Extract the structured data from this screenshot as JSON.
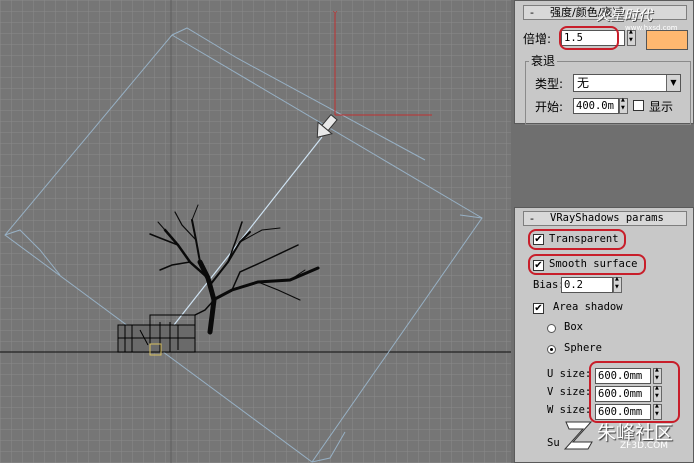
{
  "intensity_rollout": {
    "header": "强度/颜色/衰减",
    "multiplier_label": "倍增:",
    "multiplier_value": "1.5",
    "color": "#ffb870",
    "decay_group_label": "衰退",
    "type_label": "类型:",
    "type_value": "无",
    "start_label": "开始:",
    "start_value": "400.0m",
    "show_label": "显示"
  },
  "shadow_rollout": {
    "header": "VRayShadows params",
    "transparent_label": "Transparent",
    "transparent_checked": true,
    "smooth_surface_label": "Smooth surface",
    "smooth_surface_checked": true,
    "bias_label": "Bias:",
    "bias_value": "0.2",
    "area_shadow_label": "Area shadow",
    "area_shadow_checked": true,
    "box_label": "Box",
    "sphere_label": "Sphere",
    "selected_shape": "Sphere",
    "u_size_label": "U size:",
    "u_size_value": "600.0mm",
    "v_size_label": "V size:",
    "v_size_value": "600.0mm",
    "w_size_label": "W size:",
    "w_size_value": "600.0mm",
    "subdivs_label": "Su"
  },
  "watermarks": {
    "top": "火星时代",
    "top_url": "www.hxsd.com",
    "bottom": "朱峰社区",
    "bottom_url": "ZF3D.COM"
  },
  "colors": {
    "highlight": "#c81e2a",
    "viewport_bg": "#7a7a7a",
    "grid": "#8c8c8c",
    "light_gizmo": "#9ab4c8"
  }
}
